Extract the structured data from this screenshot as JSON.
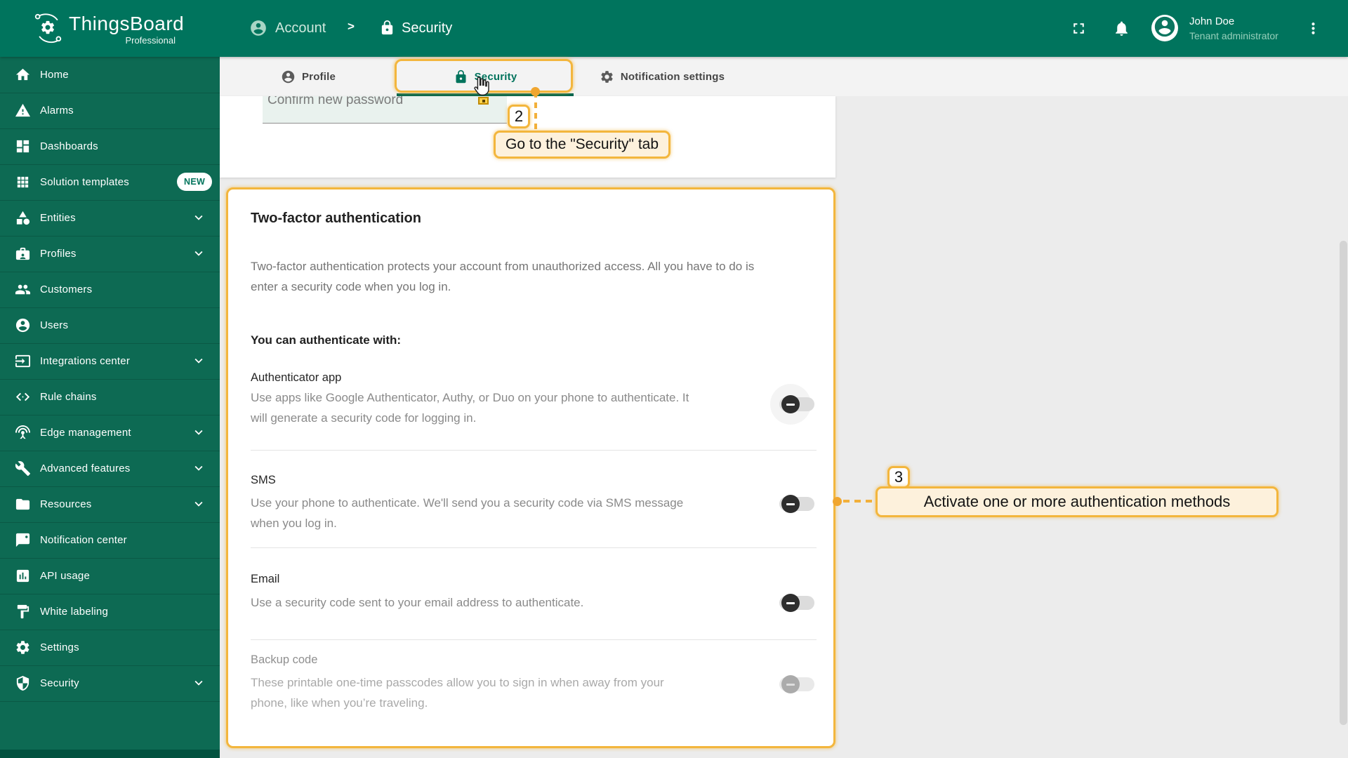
{
  "header": {
    "logo": {
      "title": "ThingsBoard",
      "subtitle": "Professional",
      "icon": "thingsboard-logo-icon"
    },
    "breadcrumb": {
      "separator": ">",
      "items": [
        {
          "icon": "person-circle-icon",
          "label": "Account"
        },
        {
          "icon": "lock-icon",
          "label": "Security"
        }
      ]
    },
    "actions": {
      "fullscreen_icon": "fullscreen-icon",
      "notifications_icon": "bell-icon",
      "menu_icon": "more-vert-icon"
    },
    "user": {
      "name": "John Doe",
      "role": "Tenant administrator",
      "avatar_icon": "person-circle-icon"
    }
  },
  "sidebar": {
    "items": [
      {
        "icon": "home-icon",
        "label": "Home"
      },
      {
        "icon": "warning-icon",
        "label": "Alarms"
      },
      {
        "icon": "dashboards-icon",
        "label": "Dashboards"
      },
      {
        "icon": "grid-icon",
        "label": "Solution templates",
        "badge": "NEW"
      },
      {
        "icon": "shapes-icon",
        "label": "Entities",
        "expandable": true
      },
      {
        "icon": "id-badge-icon",
        "label": "Profiles",
        "expandable": true
      },
      {
        "icon": "people-icon",
        "label": "Customers"
      },
      {
        "icon": "user-circle-icon",
        "label": "Users"
      },
      {
        "icon": "integration-icon",
        "label": "Integrations center",
        "expandable": true
      },
      {
        "icon": "code-icon",
        "label": "Rule chains"
      },
      {
        "icon": "antenna-icon",
        "label": "Edge management",
        "expandable": true
      },
      {
        "icon": "wrench-icon",
        "label": "Advanced features",
        "expandable": true
      },
      {
        "icon": "folder-icon",
        "label": "Resources",
        "expandable": true
      },
      {
        "icon": "chat-icon",
        "label": "Notification center"
      },
      {
        "icon": "chart-icon",
        "label": "API usage"
      },
      {
        "icon": "paint-roller-icon",
        "label": "White labeling"
      },
      {
        "icon": "gear-icon",
        "label": "Settings"
      },
      {
        "icon": "shield-icon",
        "label": "Security",
        "expandable": true
      }
    ]
  },
  "tabs": {
    "items": [
      {
        "icon": "person-icon",
        "label": "Profile",
        "active": false
      },
      {
        "icon": "lock-icon",
        "label": "Security",
        "active": true
      },
      {
        "icon": "gear-icon",
        "label": "Notification settings",
        "active": false
      }
    ]
  },
  "password_form": {
    "confirm_label": "Confirm new password"
  },
  "twofa": {
    "title": "Two-factor authentication",
    "description": "Two-factor authentication protects your account from unauthorized access. All you have to do is\nenter a security code when you log in.",
    "subtitle": "You can authenticate with:",
    "methods": [
      {
        "name": "Authenticator app",
        "description": "Use apps like Google Authenticator, Authy, or Duo on your phone to authenticate. It\nwill generate a security code for logging in.",
        "enabled": false,
        "disabled": false
      },
      {
        "name": "SMS",
        "description": "Use your phone to authenticate. We'll send you a security code via SMS message\nwhen you log in.",
        "enabled": false,
        "disabled": false
      },
      {
        "name": "Email",
        "description": "Use a security code sent to your email address to authenticate.",
        "enabled": false,
        "disabled": false
      },
      {
        "name": "Backup code",
        "description": "These printable one-time passcodes allow you to sign in when away from your\nphone, like when you’re traveling.",
        "enabled": false,
        "disabled": true
      }
    ]
  },
  "annotations": {
    "step2": {
      "number": "2",
      "label": "Go to the \"Security\" tab"
    },
    "step3": {
      "number": "3",
      "label": "Activate one or more authentication methods"
    }
  },
  "colors": {
    "header_green": "#00745d",
    "sidebar_green": "#0d6a53",
    "active_tab_green": "#00735c",
    "annotation_orange": "#f3b63d",
    "annotation_fill": "#fdf1dc"
  }
}
